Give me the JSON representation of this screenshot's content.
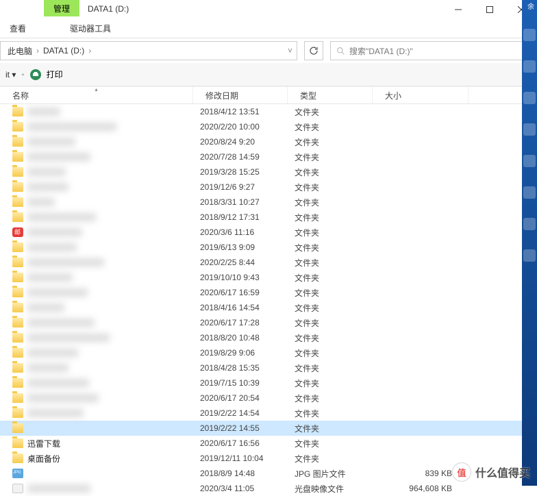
{
  "window": {
    "title": "DATA1 (D:)",
    "tab_manage": "管理"
  },
  "menu": {
    "view": "查看",
    "drive_tools": "驱动器工具"
  },
  "breadcrumb": {
    "pc": "此电脑",
    "drive": "DATA1 (D:)"
  },
  "search": {
    "placeholder": "搜索\"DATA1 (D:)\""
  },
  "toolbar": {
    "dropdown": "it ▾",
    "print": "打印"
  },
  "columns": {
    "name": "名称",
    "date": "修改日期",
    "type": "类型",
    "size": "大小"
  },
  "types": {
    "folder": "文件夹",
    "jpg": "JPG 图片文件",
    "iso": "光盘映像文件"
  },
  "files": [
    {
      "icon": "folder",
      "name": "",
      "date": "2018/4/12 13:51",
      "type": "folder",
      "size": "",
      "blur": true
    },
    {
      "icon": "folder",
      "name": "",
      "date": "2020/2/20 10:00",
      "type": "folder",
      "size": "",
      "blur": true
    },
    {
      "icon": "folder",
      "name": "",
      "date": "2020/8/24 9:20",
      "type": "folder",
      "size": "",
      "blur": true
    },
    {
      "icon": "folder",
      "name": "",
      "date": "2020/7/28 14:59",
      "type": "folder",
      "size": "",
      "blur": true
    },
    {
      "icon": "folder",
      "name": "",
      "date": "2019/3/28 15:25",
      "type": "folder",
      "size": "",
      "blur": true
    },
    {
      "icon": "folder",
      "name": "",
      "date": "2019/12/6 9:27",
      "type": "folder",
      "size": "",
      "blur": true
    },
    {
      "icon": "folder",
      "name": "",
      "date": "2018/3/31 10:27",
      "type": "folder",
      "size": "",
      "blur": true
    },
    {
      "icon": "folder",
      "name": "",
      "date": "2018/9/12 17:31",
      "type": "folder",
      "size": "",
      "blur": true
    },
    {
      "icon": "mail",
      "name": "",
      "date": "2020/3/6 11:16",
      "type": "folder",
      "size": "",
      "blur": true
    },
    {
      "icon": "folder",
      "name": "",
      "date": "2019/6/13 9:09",
      "type": "folder",
      "size": "",
      "blur": true
    },
    {
      "icon": "folder",
      "name": "",
      "date": "2020/2/25 8:44",
      "type": "folder",
      "size": "",
      "blur": true
    },
    {
      "icon": "folder",
      "name": "",
      "date": "2019/10/10 9:43",
      "type": "folder",
      "size": "",
      "blur": true
    },
    {
      "icon": "folder",
      "name": "",
      "date": "2020/6/17 16:59",
      "type": "folder",
      "size": "",
      "blur": true
    },
    {
      "icon": "folder",
      "name": "",
      "date": "2018/4/16 14:54",
      "type": "folder",
      "size": "",
      "blur": true
    },
    {
      "icon": "folder",
      "name": "",
      "date": "2020/6/17 17:28",
      "type": "folder",
      "size": "",
      "blur": true
    },
    {
      "icon": "folder",
      "name": "",
      "date": "2018/8/20 10:48",
      "type": "folder",
      "size": "",
      "blur": true
    },
    {
      "icon": "folder",
      "name": "",
      "date": "2019/8/29 9:06",
      "type": "folder",
      "size": "",
      "blur": true
    },
    {
      "icon": "folder",
      "name": "",
      "date": "2018/4/28 15:35",
      "type": "folder",
      "size": "",
      "blur": true
    },
    {
      "icon": "folder",
      "name": "",
      "date": "2019/7/15 10:39",
      "type": "folder",
      "size": "",
      "blur": true
    },
    {
      "icon": "folder",
      "name": "",
      "date": "2020/6/17 20:54",
      "type": "folder",
      "size": "",
      "blur": true
    },
    {
      "icon": "folder",
      "name": "",
      "date": "2019/2/22 14:54",
      "type": "folder",
      "size": "",
      "blur": true
    },
    {
      "icon": "folder",
      "name": "",
      "date": "2019/2/22 14:55",
      "type": "folder",
      "size": "",
      "selected": true
    },
    {
      "icon": "folder",
      "name": "迅雷下载",
      "date": "2020/6/17 16:56",
      "type": "folder",
      "size": ""
    },
    {
      "icon": "folder",
      "name": "桌面备份",
      "date": "2019/12/11 10:04",
      "type": "folder",
      "size": ""
    },
    {
      "icon": "jpg",
      "name": "",
      "date": "2018/8/9 14:48",
      "type": "jpg",
      "size": "839 KB"
    },
    {
      "icon": "iso",
      "name": "",
      "date": "2020/3/4 11:05",
      "type": "iso",
      "size": "964,608 KB",
      "blur": true
    }
  ],
  "watermark": {
    "badge": "值",
    "text": "什么值得买"
  },
  "rightedge": {
    "label": "余"
  }
}
